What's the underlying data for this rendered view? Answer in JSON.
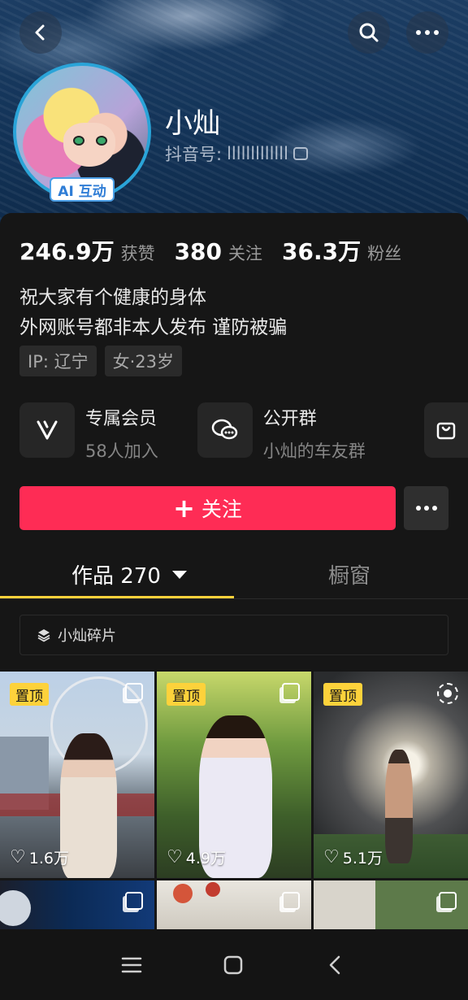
{
  "header": {
    "back_icon": "back-arrow-icon",
    "search_icon": "search-icon",
    "more_icon": "more-dots-icon"
  },
  "profile": {
    "ai_badge": "AI 互动",
    "nickname": "小灿",
    "douyin_id_label": "抖音号:",
    "douyin_id_value": "lllllllllllll",
    "copy_icon": "copy-icon"
  },
  "stats": [
    {
      "value": "246.9万",
      "label": "获赞"
    },
    {
      "value": "380",
      "label": "关注"
    },
    {
      "value": "36.3万",
      "label": "粉丝"
    }
  ],
  "bio": {
    "line1": "祝大家有个健康的身体",
    "line2": "外网账号都非本人发布  谨防被骗"
  },
  "tags": [
    "IP: 辽宁",
    "女·23岁"
  ],
  "features": [
    {
      "title": "专属会员",
      "subtitle": "58人加入",
      "icon": "vip-v-icon"
    },
    {
      "title": "公开群",
      "subtitle": "小灿的车友群",
      "icon": "group-chat-icon"
    }
  ],
  "shop_icon": "shopping-bag-icon",
  "actions": {
    "follow_label": "关注",
    "more_icon": "more-dots-icon"
  },
  "tabs": {
    "works_label": "作品 270",
    "window_label": "橱窗"
  },
  "collection": {
    "label": "小灿碎片",
    "icon": "layers-icon"
  },
  "posts": [
    {
      "pinned": "置顶",
      "likes": "1.6万",
      "badge_icon": "multi-image-icon"
    },
    {
      "pinned": "置顶",
      "likes": "4.9万",
      "badge_icon": "multi-image-icon"
    },
    {
      "pinned": "置顶",
      "likes": "5.1万",
      "badge_icon": "live-photo-icon"
    }
  ],
  "colors": {
    "accent_red": "#fe2c55",
    "tab_underline": "#fdd23b",
    "pin_badge": "#fdd23b",
    "background": "#161616"
  }
}
